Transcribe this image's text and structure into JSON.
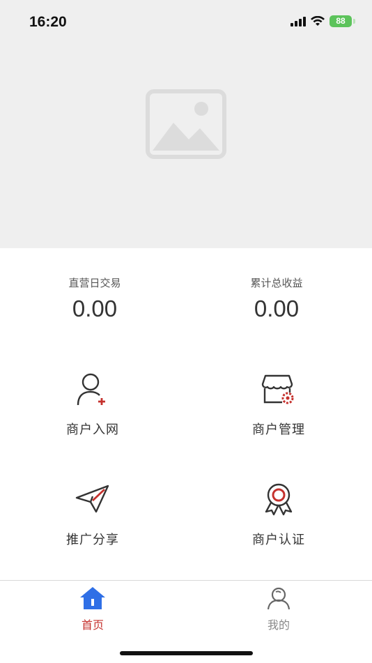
{
  "status_bar": {
    "time": "16:20",
    "battery": "88"
  },
  "stats": [
    {
      "label": "直营日交易",
      "value": "0.00"
    },
    {
      "label": "累计总收益",
      "value": "0.00"
    }
  ],
  "menu": [
    {
      "label": "商户入网",
      "icon": "add-user-icon"
    },
    {
      "label": "商户管理",
      "icon": "store-settings-icon"
    },
    {
      "label": "推广分享",
      "icon": "paper-plane-icon"
    },
    {
      "label": "商户认证",
      "icon": "certificate-badge-icon"
    }
  ],
  "tabs": [
    {
      "label": "首页",
      "icon": "home-icon",
      "active": true
    },
    {
      "label": "我的",
      "icon": "user-icon",
      "active": false
    }
  ],
  "colors": {
    "accent": "#c5312d",
    "tab_active": "#2f6fe6",
    "tab_inactive": "#888888"
  }
}
